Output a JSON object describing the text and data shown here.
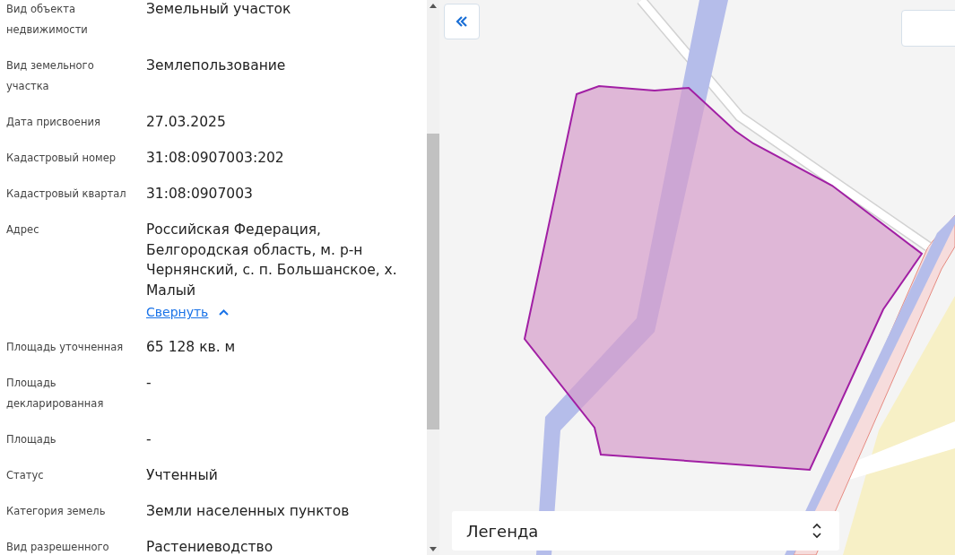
{
  "details": [
    {
      "label": "Вид объекта недвижимости",
      "value": "Земельный участок"
    },
    {
      "label": "Вид земельного участка",
      "value": "Землепользование"
    },
    {
      "label": "Дата присвоения",
      "value": "27.03.2025"
    },
    {
      "label": "Кадастровый номер",
      "value": "31:08:0907003:202"
    },
    {
      "label": "Кадастровый квартал",
      "value": "31:08:0907003"
    },
    {
      "label": "Адрес",
      "value": "Российская Федерация, Белгородская область, м. р-н Чернянский, с. п. Большанское, х. Малый",
      "toggle": {
        "label": "Свернуть",
        "expanded": true
      }
    },
    {
      "label": "Площадь уточненная",
      "value": "65 128 кв. м"
    },
    {
      "label": "Площадь декларированная",
      "value": "-"
    },
    {
      "label": "Площадь",
      "value": "-"
    },
    {
      "label": "Статус",
      "value": "Учтенный"
    },
    {
      "label": "Категория земель",
      "value": "Земли населенных пунктов"
    },
    {
      "label": "Вид разрешенного",
      "value": "Растениеводство"
    }
  ],
  "map": {
    "kind": "picture",
    "legend": {
      "label": "Легенда"
    }
  }
}
